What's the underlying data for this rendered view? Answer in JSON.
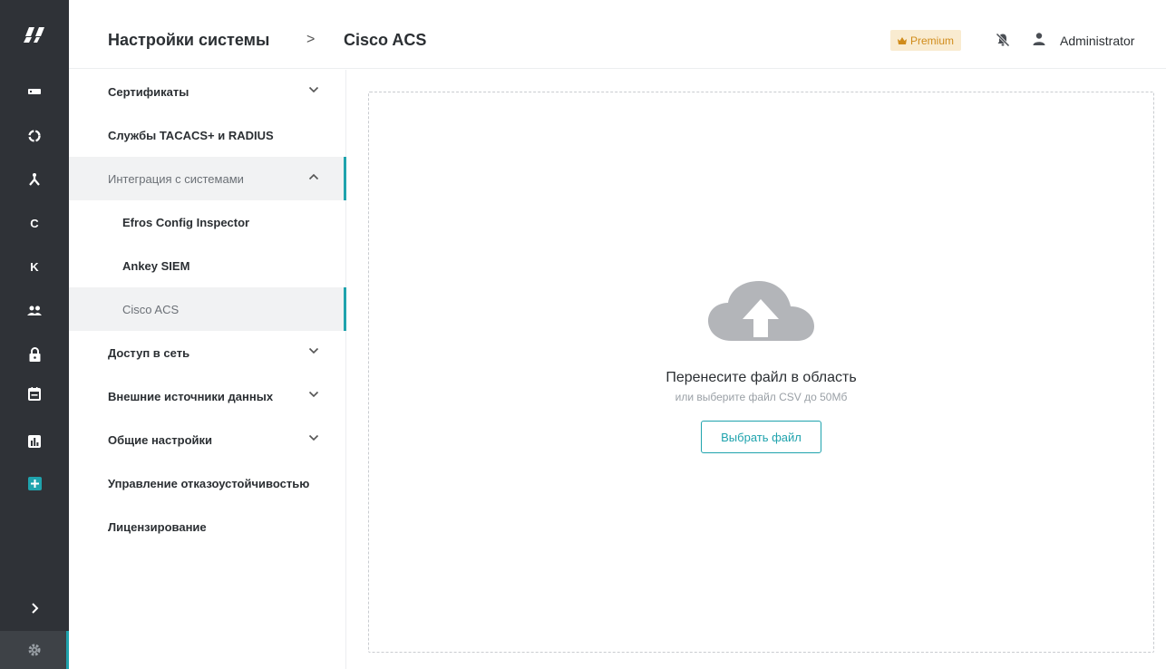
{
  "breadcrumb": {
    "root": "Настройки системы",
    "separator": ">",
    "current": "Cisco ACS"
  },
  "header": {
    "premium_label": "Premium",
    "user_name": "Administrator"
  },
  "rail": {
    "letter_c": "C",
    "letter_k": "K"
  },
  "menu": {
    "certificates": "Сертификаты",
    "tacacs": "Службы TACACS+ и RADIUS",
    "integration": "Интеграция с системами",
    "efros": "Efros Config Inspector",
    "ankey": "Ankey SIEM",
    "cisco": "Cisco ACS",
    "network_access": "Доступ в сеть",
    "external_sources": "Внешние источники данных",
    "general": "Общие настройки",
    "failover": "Управление отказоустойчивостью",
    "licensing": "Лицензирование"
  },
  "dropzone": {
    "title": "Перенесите файл в область",
    "subtitle": "или выберите файл CSV до 50Мб",
    "button": "Выбрать файл"
  },
  "colors": {
    "accent": "#1fa3ad",
    "rail_bg": "#2f3237",
    "premium_bg": "#f9ebd0",
    "premium_text": "#d08b1a"
  }
}
